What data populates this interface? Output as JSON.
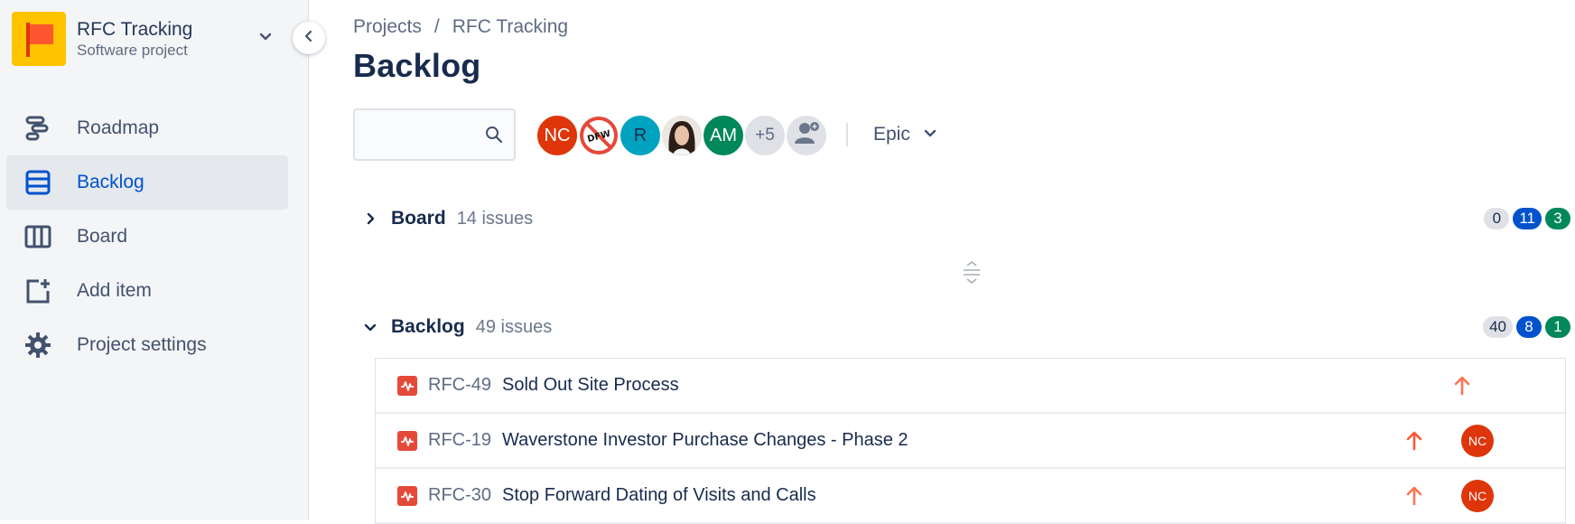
{
  "sidebar": {
    "project_name": "RFC Tracking",
    "project_type": "Software project",
    "items": [
      {
        "label": "Roadmap",
        "icon": "roadmap-icon"
      },
      {
        "label": "Backlog",
        "icon": "backlog-icon",
        "active": true
      },
      {
        "label": "Board",
        "icon": "board-icon"
      },
      {
        "label": "Add item",
        "icon": "add-item-icon"
      },
      {
        "label": "Project settings",
        "icon": "gear-icon"
      }
    ]
  },
  "breadcrumb": {
    "projects": "Projects",
    "separator": "/",
    "current": "RFC Tracking"
  },
  "page_title": "Backlog",
  "search": {
    "placeholder": "",
    "value": ""
  },
  "avatars": [
    {
      "initials": "NC",
      "color": "#de350b"
    },
    {
      "initials": "",
      "color": "#ffffff",
      "kind": "image-logo"
    },
    {
      "initials": "R",
      "color": "#00a3bf"
    },
    {
      "initials": "",
      "color": "#c9b8a8",
      "kind": "photo"
    },
    {
      "initials": "AM",
      "color": "#00875a"
    },
    {
      "initials": "+5",
      "color": "#dfe1e6"
    }
  ],
  "epic_filter": {
    "label": "Epic"
  },
  "board_section": {
    "name": "Board",
    "count": "14 issues",
    "badges": [
      "0",
      "11",
      "3"
    ]
  },
  "backlog_section": {
    "name": "Backlog",
    "count": "49 issues",
    "badges": [
      "40",
      "8",
      "1"
    ]
  },
  "issues": [
    {
      "key": "RFC-49",
      "summary": "Sold Out Site Process",
      "priority": "high",
      "assignee": ""
    },
    {
      "key": "RFC-19",
      "summary": "Waverstone Investor Purchase Changes - Phase 2",
      "priority": "highest",
      "assignee": "NC"
    },
    {
      "key": "RFC-30",
      "summary": "Stop Forward Dating of Visits and Calls",
      "priority": "high",
      "assignee": "NC"
    }
  ],
  "colors": {
    "accent": "#0052cc",
    "high_priority": "#ff7452",
    "highest_priority": "#ff5630",
    "issue_type": "#e5493a"
  }
}
